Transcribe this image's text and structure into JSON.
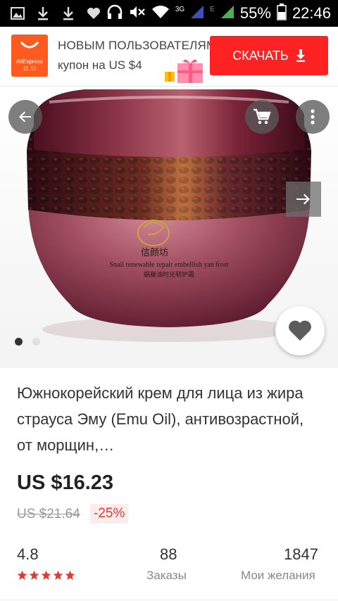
{
  "status_bar": {
    "icons": [
      "gallery-icon",
      "download-icon",
      "download-icon",
      "heart-icon",
      "headset-icon",
      "mute-icon",
      "wifi-icon",
      "signal-icon",
      "signal-icon"
    ],
    "net_3g": "3G",
    "net_e": "E",
    "battery": "55%",
    "time": "22:46"
  },
  "banner": {
    "logo_brand": "AliExpress",
    "logo_sale": "11.11",
    "line1": "НОВЫМ ПОЛЬЗОВАТЕЛЯМ",
    "line2": "купон на US $4",
    "download_label": "СКАЧАТЬ",
    "accent": "#ff2222"
  },
  "product": {
    "jar_text": "Snail renewable repair embellish yan frost",
    "title": "Южнокорейский крем для лица из жира страуса Эму (Emu Oil), антивозрастной, от морщин,…",
    "price": "US $16.23",
    "old_price": "US $21.64",
    "discount": "-25%",
    "carousel": {
      "current": 1,
      "total": 2
    }
  },
  "stats": {
    "rating": "4.8",
    "stars": 5,
    "orders_value": "88",
    "orders_label": "Заказы",
    "wishes_value": "1847",
    "wishes_label": "Мои желания"
  }
}
